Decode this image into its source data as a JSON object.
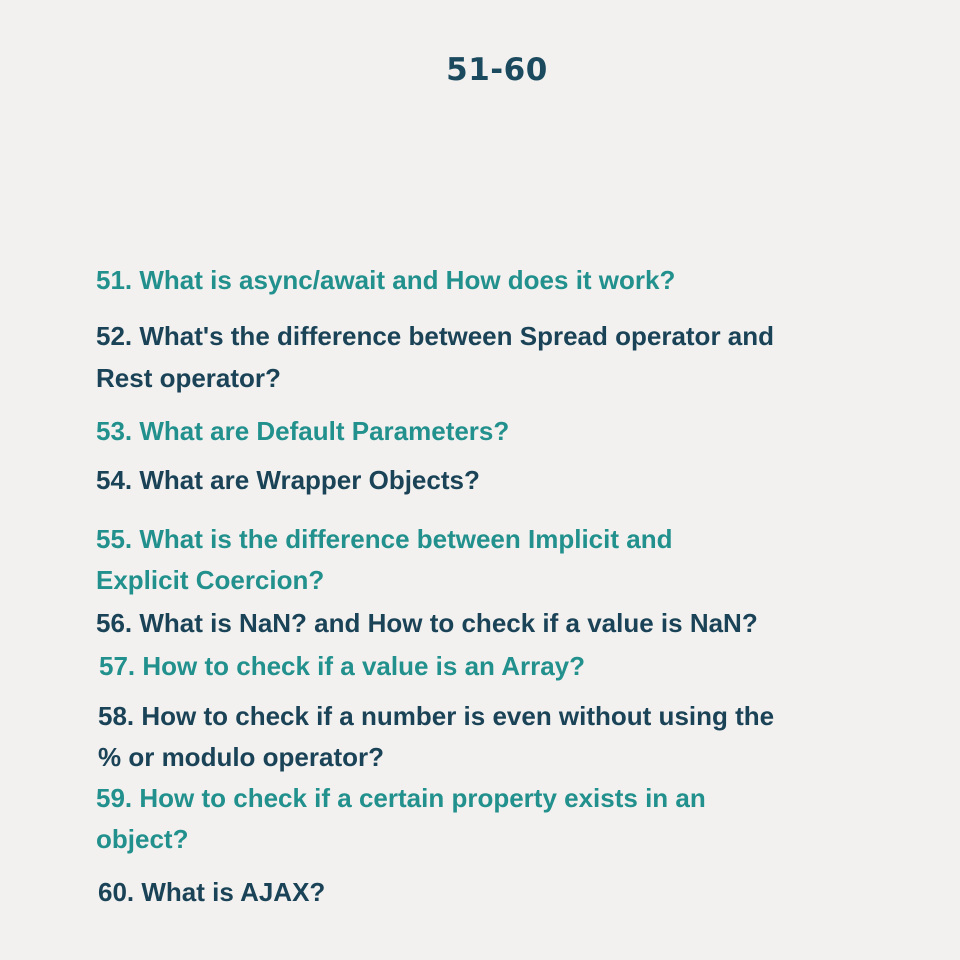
{
  "header": {
    "title": "51-60"
  },
  "colors": {
    "background": "#f2f1ef",
    "title": "#1b4a5f",
    "teal_text": "#22918d",
    "navy_text": "#1b4357"
  },
  "questions": [
    {
      "lines": [
        "51. What is async/await and How does it work?"
      ],
      "color": "teal"
    },
    {
      "lines": [
        "52. What's the difference between Spread operator and",
        "Rest operator?"
      ],
      "color": "navy"
    },
    {
      "lines": [
        "53. What are Default Parameters?"
      ],
      "color": "teal"
    },
    {
      "lines": [
        "54. What are Wrapper Objects?"
      ],
      "color": "navy"
    },
    {
      "lines": [
        "55. What is the difference between Implicit and",
        "Explicit Coercion?"
      ],
      "color": "teal"
    },
    {
      "lines": [
        "56. What is NaN? and How to check if a value is NaN?"
      ],
      "color": "navy"
    },
    {
      "lines": [
        "57. How to check if a value is an Array?"
      ],
      "color": "teal"
    },
    {
      "lines": [
        "58. How to check if a number is even without using the",
        "% or modulo operator?"
      ],
      "color": "navy"
    },
    {
      "lines": [
        "59. How to check if a certain property exists in an",
        "object?"
      ],
      "color": "teal"
    },
    {
      "lines": [
        "60. What is AJAX?"
      ],
      "color": "navy"
    }
  ]
}
